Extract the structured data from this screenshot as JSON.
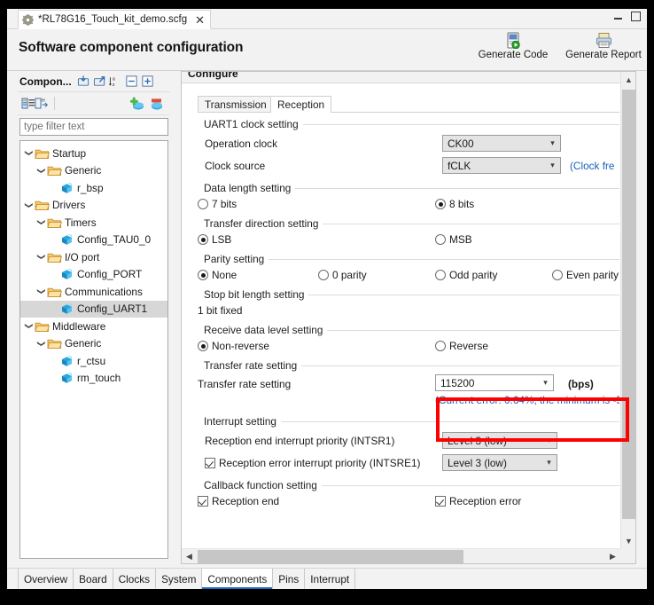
{
  "window": {
    "tab_label": "*RL78G16_Touch_kit_demo.scfg",
    "tab_icon": "gear-icon",
    "close_glyph": "✕",
    "minimize": "minimize-button",
    "maximize": "maximize-button"
  },
  "header": {
    "title": "Software component configuration",
    "actions": [
      {
        "label": "Generate Code",
        "icon": "generate-code-icon"
      },
      {
        "label": "Generate Report",
        "icon": "generate-report-icon"
      }
    ]
  },
  "left_panel": {
    "title": "Compon...",
    "tools": [
      {
        "name": "import-icon"
      },
      {
        "name": "export-icon"
      },
      {
        "name": "sort-alpha-icon"
      },
      {
        "name": "collapse-all-icon"
      },
      {
        "name": "expand-all-icon"
      }
    ],
    "toolbar2": [
      {
        "name": "show-components-icon"
      },
      {
        "name": "filter-hardware-icon"
      },
      {
        "name": "add-component-icon"
      },
      {
        "name": "remove-component-icon"
      }
    ],
    "filter_placeholder": "type filter text",
    "tree": [
      {
        "label": "Startup",
        "depth": 0,
        "type": "folder",
        "expanded": true,
        "selected": false
      },
      {
        "label": "Generic",
        "depth": 1,
        "type": "folder",
        "expanded": true,
        "selected": false
      },
      {
        "label": "r_bsp",
        "depth": 2,
        "type": "component",
        "expanded": null,
        "selected": false
      },
      {
        "label": "Drivers",
        "depth": 0,
        "type": "folder",
        "expanded": true,
        "selected": false
      },
      {
        "label": "Timers",
        "depth": 1,
        "type": "folder",
        "expanded": true,
        "selected": false
      },
      {
        "label": "Config_TAU0_0",
        "depth": 2,
        "type": "component",
        "expanded": null,
        "selected": false
      },
      {
        "label": "I/O port",
        "depth": 1,
        "type": "folder",
        "expanded": true,
        "selected": false
      },
      {
        "label": "Config_PORT",
        "depth": 2,
        "type": "component",
        "expanded": null,
        "selected": false
      },
      {
        "label": "Communications",
        "depth": 1,
        "type": "folder",
        "expanded": true,
        "selected": false
      },
      {
        "label": "Config_UART1",
        "depth": 2,
        "type": "component",
        "expanded": null,
        "selected": true
      },
      {
        "label": "Middleware",
        "depth": 0,
        "type": "folder",
        "expanded": true,
        "selected": false
      },
      {
        "label": "Generic",
        "depth": 1,
        "type": "folder",
        "expanded": true,
        "selected": false
      },
      {
        "label": "r_ctsu",
        "depth": 2,
        "type": "component",
        "expanded": null,
        "selected": false
      },
      {
        "label": "rm_touch",
        "depth": 2,
        "type": "component",
        "expanded": null,
        "selected": false
      }
    ]
  },
  "right_panel": {
    "caption": "Configure",
    "tabs": [
      {
        "label": "Transmission",
        "active": false
      },
      {
        "label": "Reception",
        "active": true
      }
    ],
    "groups": {
      "clock": {
        "title": "UART1 clock setting",
        "operation_clock_label": "Operation clock",
        "operation_clock_value": "CK00",
        "clock_source_label": "Clock source",
        "clock_source_value": "fCLK",
        "clock_freq_link": "(Clock fre"
      },
      "data_length": {
        "title": "Data length setting",
        "options": [
          {
            "label": "7 bits",
            "selected": false
          },
          {
            "label": "8 bits",
            "selected": true
          }
        ]
      },
      "transfer_direction": {
        "title": "Transfer direction setting",
        "options": [
          {
            "label": "LSB",
            "selected": true
          },
          {
            "label": "MSB",
            "selected": false
          }
        ]
      },
      "parity": {
        "title": "Parity setting",
        "options": [
          {
            "label": "None",
            "selected": true
          },
          {
            "label": "0 parity",
            "selected": false
          },
          {
            "label": "Odd parity",
            "selected": false
          },
          {
            "label": "Even parity",
            "selected": false
          }
        ]
      },
      "stop_bit": {
        "title": "Stop bit length setting",
        "value": "1 bit fixed"
      },
      "receive_level": {
        "title": "Receive data level setting",
        "options": [
          {
            "label": "Non-reverse",
            "selected": true
          },
          {
            "label": "Reverse",
            "selected": false
          }
        ]
      },
      "transfer_rate": {
        "title": "Transfer rate setting",
        "label": "Transfer rate setting",
        "value": "115200",
        "unit": "(bps)",
        "error_note": "(Current error: 0.64%, the minimum is -5",
        "highlight_color": "#ff0000"
      },
      "interrupt": {
        "title": "Interrupt setting",
        "rows": [
          {
            "label": "Reception end interrupt priority (INTSR1)",
            "checkbox": null,
            "value": "Level 3 (low)"
          },
          {
            "label": "Reception error interrupt priority (INTSRE1)",
            "checkbox": true,
            "value": "Level 3 (low)"
          }
        ]
      },
      "callback": {
        "title": "Callback function setting",
        "options": [
          {
            "label": "Reception end",
            "checked": true
          },
          {
            "label": "Reception error",
            "checked": true
          }
        ]
      }
    }
  },
  "bottom_tabs": [
    {
      "label": "Overview",
      "active": false
    },
    {
      "label": "Board",
      "active": false
    },
    {
      "label": "Clocks",
      "active": false
    },
    {
      "label": "System",
      "active": false
    },
    {
      "label": "Components",
      "active": true
    },
    {
      "label": "Pins",
      "active": false
    },
    {
      "label": "Interrupt",
      "active": false
    }
  ]
}
